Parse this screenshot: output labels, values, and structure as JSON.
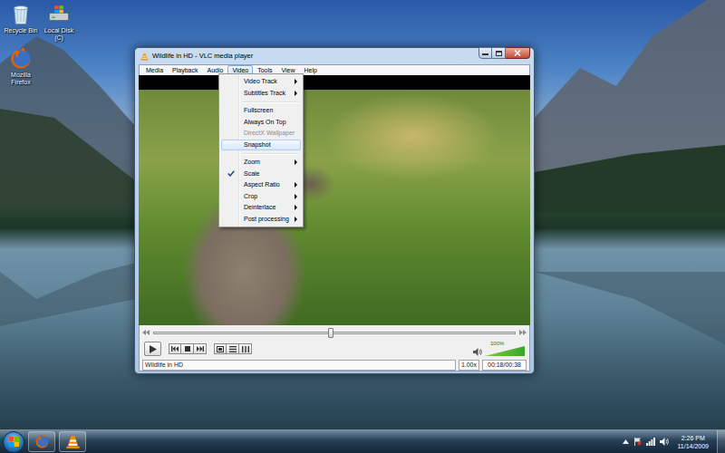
{
  "desktop": {
    "icons": [
      {
        "label": "Recycle Bin",
        "kind": "recycle"
      },
      {
        "label": "Local Disk (C)",
        "kind": "drive"
      },
      {
        "label": "Mozilla Firefox",
        "kind": "browser"
      }
    ]
  },
  "window": {
    "title": "Wildlife in HD - VLC media player"
  },
  "menubar": [
    {
      "label": "Media",
      "selected": false
    },
    {
      "label": "Playback",
      "selected": false
    },
    {
      "label": "Audio",
      "selected": false
    },
    {
      "label": "Video",
      "selected": true
    },
    {
      "label": "Tools",
      "selected": false
    },
    {
      "label": "View",
      "selected": false
    },
    {
      "label": "Help",
      "selected": false
    }
  ],
  "video_menu": {
    "groups": [
      [
        {
          "label": "Video Track",
          "submenu": true,
          "checked": false,
          "disabled": false,
          "selected": false
        },
        {
          "label": "Subtitles Track",
          "submenu": true,
          "checked": false,
          "disabled": false,
          "selected": false
        }
      ],
      [
        {
          "label": "Fullscreen",
          "submenu": false,
          "checked": false,
          "disabled": false,
          "selected": false
        },
        {
          "label": "Always On Top",
          "submenu": false,
          "checked": false,
          "disabled": false,
          "selected": false
        },
        {
          "label": "DirectX Wallpaper",
          "submenu": false,
          "checked": false,
          "disabled": true,
          "selected": false
        },
        {
          "label": "Snapshot",
          "submenu": false,
          "checked": false,
          "disabled": false,
          "selected": true
        }
      ],
      [
        {
          "label": "Zoom",
          "submenu": true,
          "checked": false,
          "disabled": false,
          "selected": false
        },
        {
          "label": "Scale",
          "submenu": false,
          "checked": true,
          "disabled": false,
          "selected": false
        },
        {
          "label": "Aspect Ratio",
          "submenu": true,
          "checked": false,
          "disabled": false,
          "selected": false
        },
        {
          "label": "Crop",
          "submenu": true,
          "checked": false,
          "disabled": false,
          "selected": false
        },
        {
          "label": "Deinterlace",
          "submenu": true,
          "checked": false,
          "disabled": false,
          "selected": false
        },
        {
          "label": "Post processing",
          "submenu": true,
          "checked": false,
          "disabled": false,
          "selected": false
        }
      ]
    ]
  },
  "seek": {
    "level": 0.49
  },
  "volume": {
    "level": 1.0,
    "reading": "100%"
  },
  "status_bar": {
    "title": "Wildlife in HD",
    "speed": "1.00x",
    "time": "00:18/00:38"
  },
  "taskbar": {
    "time": "2:26 PM",
    "date": "11/14/2009"
  }
}
